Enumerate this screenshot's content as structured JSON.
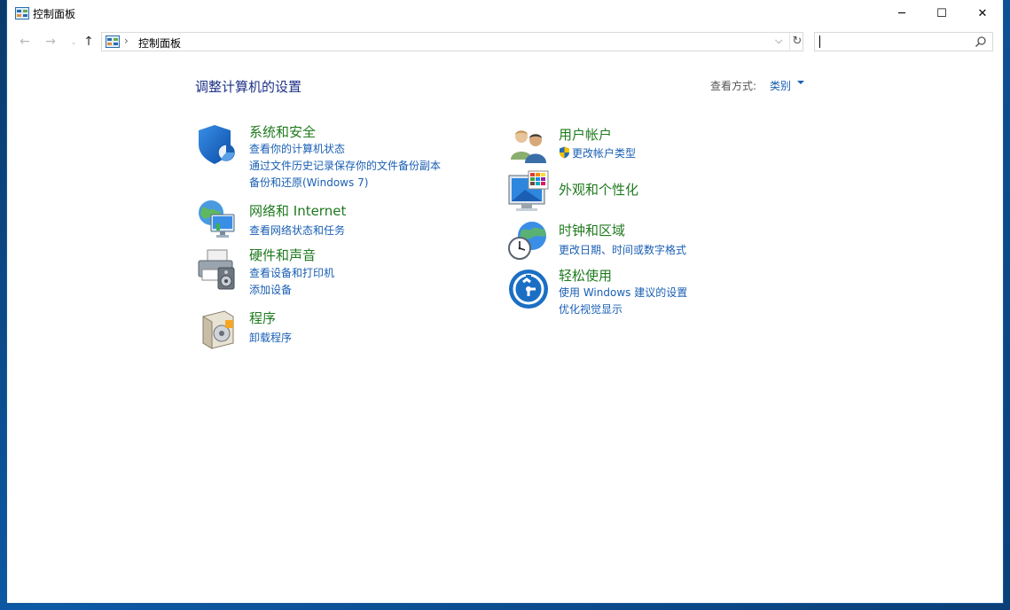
{
  "window": {
    "title": "控制面板",
    "minimize_glyph": "─",
    "maximize_glyph": "☐",
    "close_glyph": "✕"
  },
  "navigation": {
    "back_glyph": "←",
    "forward_glyph": "→",
    "recent_glyph": "⌄",
    "up_glyph": "↑",
    "breadcrumb_separator": "›",
    "address": "控制面板",
    "dropdown_glyph": "⌵",
    "refresh_glyph": "↻",
    "search_placeholder": ""
  },
  "header": {
    "title": "调整计算机的设置",
    "view_by_label": "查看方式:",
    "view_by_value": "类别"
  },
  "categories_left": [
    {
      "title": "系统和安全",
      "icon": "shield-icon",
      "links": [
        "查看你的计算机状态",
        "通过文件历史记录保存你的文件备份副本",
        "备份和还原(Windows 7)"
      ]
    },
    {
      "title": "网络和 Internet",
      "icon": "network-globe-icon",
      "links": [
        "查看网络状态和任务"
      ]
    },
    {
      "title": "硬件和声音",
      "icon": "printer-speaker-icon",
      "links": [
        "查看设备和打印机",
        "添加设备"
      ]
    },
    {
      "title": "程序",
      "icon": "program-disc-icon",
      "links": [
        "卸载程序"
      ]
    }
  ],
  "categories_right": [
    {
      "title": "用户帐户",
      "icon": "users-icon",
      "links": [
        "更改帐户类型"
      ]
    },
    {
      "title": "外观和个性化",
      "icon": "monitor-palette-icon",
      "links": []
    },
    {
      "title": "时钟和区域",
      "icon": "clock-globe-icon",
      "links": [
        "更改日期、时间或数字格式"
      ]
    },
    {
      "title": "轻松使用",
      "icon": "ease-of-access-icon",
      "links": [
        "使用 Windows 建议的设置",
        "优化视觉显示"
      ]
    }
  ],
  "colors": {
    "category_title": "#1f7a1f",
    "link": "#1a5fb4",
    "heading": "#1e3287",
    "desktop": "#0c5aa6"
  }
}
